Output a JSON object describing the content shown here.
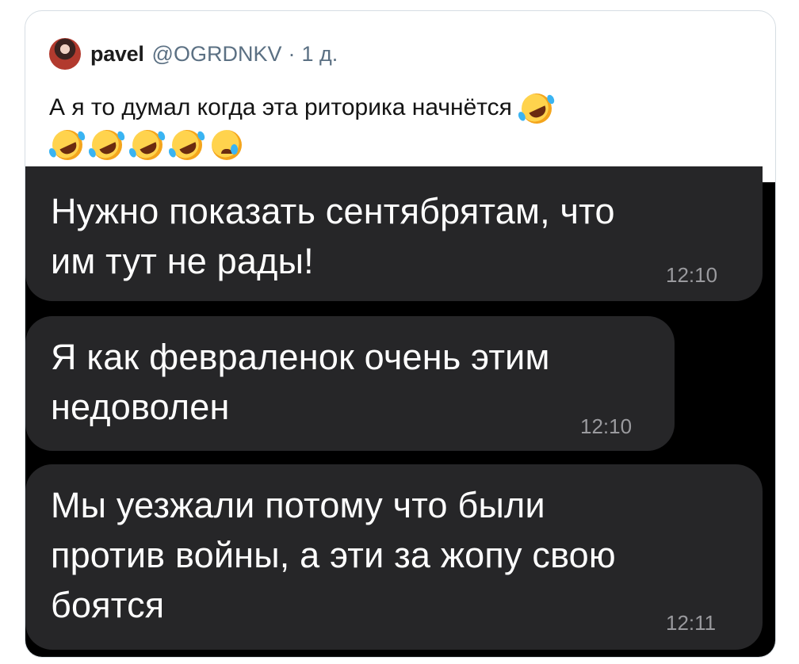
{
  "tweet": {
    "author_name": "pavel",
    "author_handle": "@OGRDNKV",
    "separator": "·",
    "age": "1 д.",
    "text": "А я то думал когда эта риторика начнётся",
    "emojis": [
      "rolling-on-floor-laughing",
      "rolling-on-floor-laughing",
      "rolling-on-floor-laughing",
      "rolling-on-floor-laughing",
      "rolling-on-floor-laughing",
      "crying-face"
    ]
  },
  "chat": {
    "messages": [
      {
        "lines": [
          "Нужно показать сентябрятам, что",
          "им тут не рады!"
        ],
        "time": "12:10"
      },
      {
        "lines": [
          "Я как февраленок очень этим",
          "недоволен"
        ],
        "time": "12:10"
      },
      {
        "lines": [
          "Мы уезжали потому что были",
          "против войны, а эти за жопу свою",
          "боятся"
        ],
        "time": "12:11"
      }
    ]
  },
  "colors": {
    "border": "#d6dde3",
    "secondary_text": "#5b7083",
    "chat_background": "#000000",
    "bubble": "#262628",
    "time_text": "#9a9a9e"
  }
}
